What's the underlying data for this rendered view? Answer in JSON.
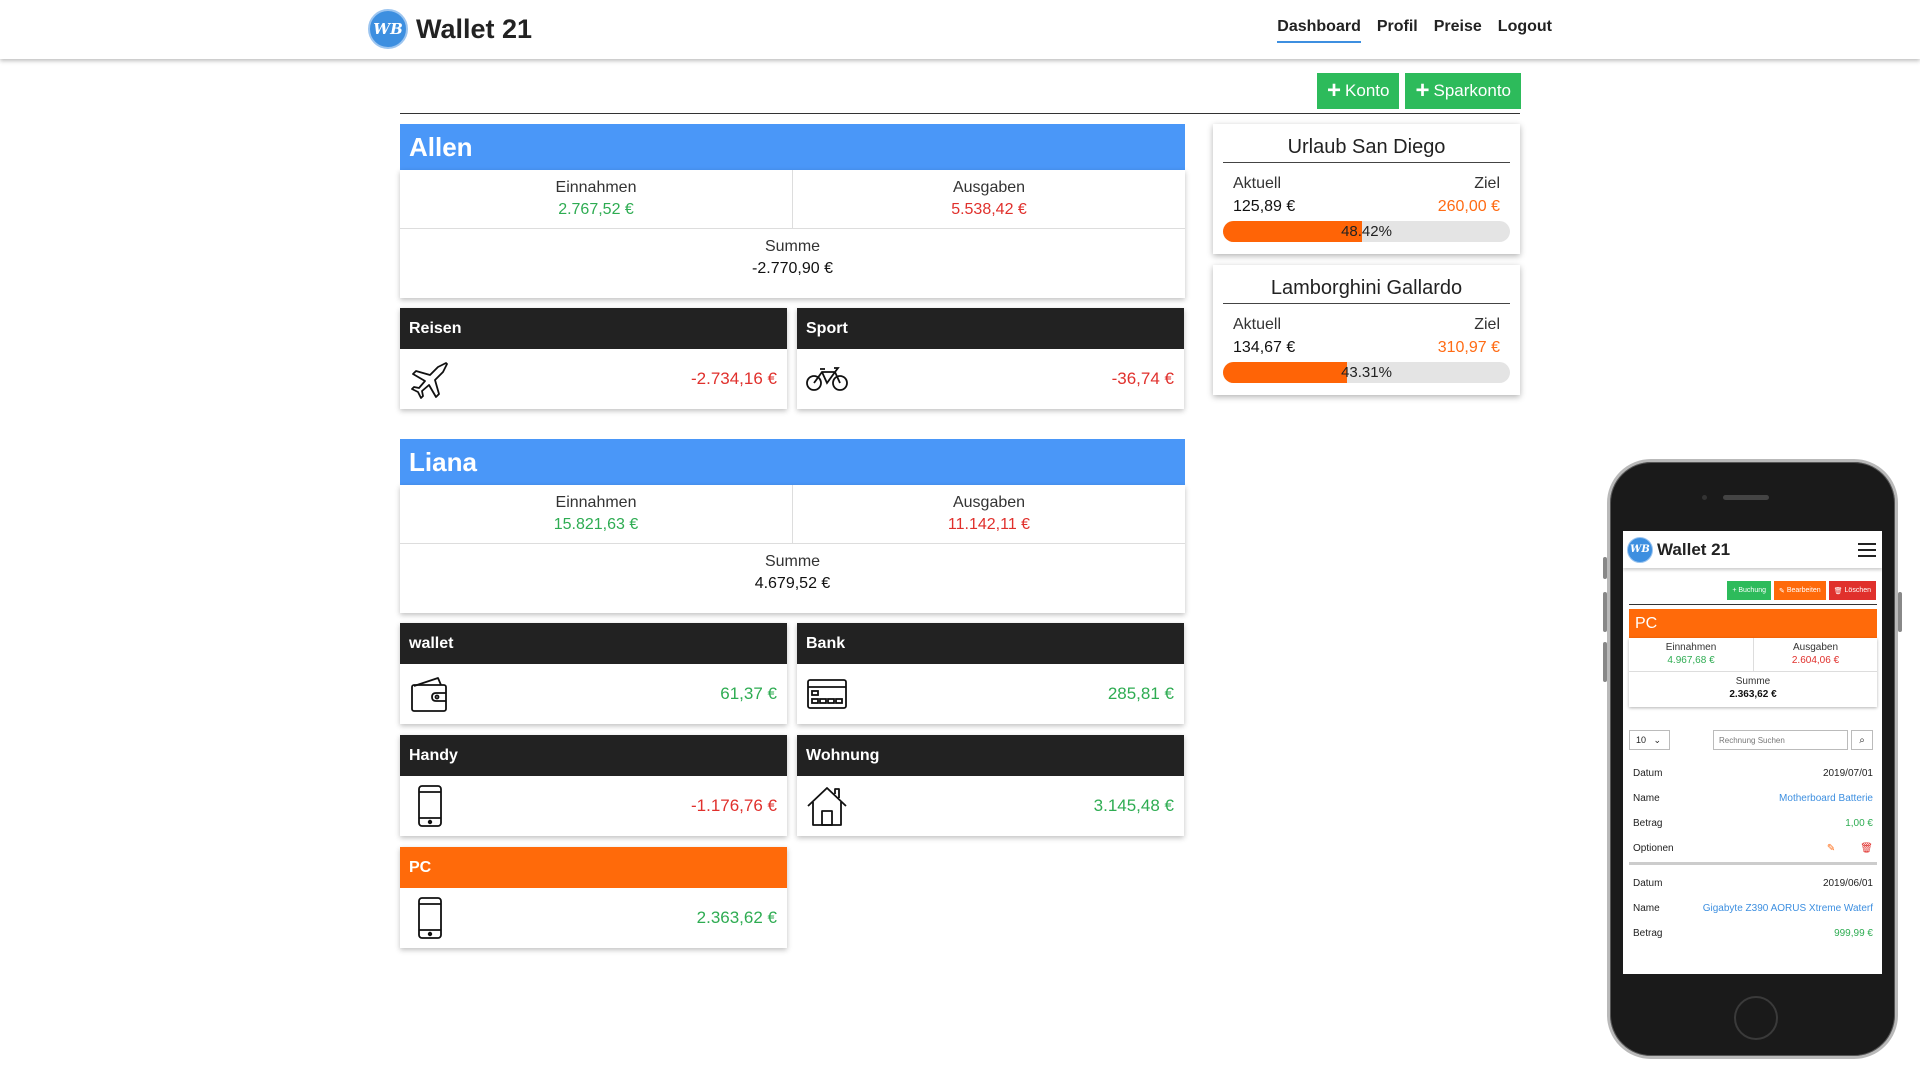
{
  "header": {
    "brand_logo": "WB",
    "brand": "Wallet 21",
    "nav": [
      "Dashboard",
      "Profil",
      "Preise",
      "Logout"
    ],
    "active_nav": "Dashboard"
  },
  "actions": {
    "add_account": "Konto",
    "add_savings": "Sparkonto"
  },
  "groups": [
    {
      "name": "Allen",
      "income_label": "Einnahmen",
      "income": "2.767,52 €",
      "expense_label": "Ausgaben",
      "expense": "5.538,42 €",
      "sum_label": "Summe",
      "sum": "-2.770,90 €",
      "accounts": [
        {
          "name": "Reisen",
          "icon": "airplane-icon",
          "value": "-2.734,16 €"
        },
        {
          "name": "Sport",
          "icon": "bicycle-icon",
          "value": "-36,74 €"
        }
      ]
    },
    {
      "name": "Liana",
      "income_label": "Einnahmen",
      "income": "15.821,63 €",
      "expense_label": "Ausgaben",
      "expense": "11.142,11 €",
      "sum_label": "Summe",
      "sum": "4.679,52 €",
      "accounts": [
        {
          "name": "wallet",
          "icon": "wallet-icon",
          "value": "61,37 €"
        },
        {
          "name": "Bank",
          "icon": "credit-card-icon",
          "value": "285,81 €"
        },
        {
          "name": "Handy",
          "icon": "smartphone-icon",
          "value": "-1.176,76 €"
        },
        {
          "name": "Wohnung",
          "icon": "house-icon",
          "value": "3.145,48 €"
        },
        {
          "name": "PC",
          "icon": "smartphone-icon",
          "value": "2.363,62 €"
        }
      ]
    }
  ],
  "goals": [
    {
      "title": "Urlaub San Diego",
      "current_label": "Aktuell",
      "target_label": "Ziel",
      "current": "125,89 €",
      "target": "260,00 €",
      "percent_text": "48.42%",
      "progress": 0.4842
    },
    {
      "title": "Lamborghini Gallardo",
      "current_label": "Aktuell",
      "target_label": "Ziel",
      "current": "134,67 €",
      "target": "310,97 €",
      "percent_text": "43.31%",
      "progress": 0.4331
    }
  ],
  "mobile": {
    "brand_logo": "WB",
    "brand": "Wallet 21",
    "buttons": [
      "Buchung",
      "Bearbeiten",
      "Löschen"
    ],
    "account": "PC",
    "income_label": "Einnahmen",
    "income": "4.967,68 €",
    "expense_label": "Ausgaben",
    "expense": "2.604,06 €",
    "sum_label": "Summe",
    "sum": "2.363,62 €",
    "page_size": "10",
    "search_placeholder": "Rechnung Suchen",
    "entries": [
      {
        "date_label": "Datum",
        "date": "2019/07/01",
        "name_label": "Name",
        "name": "Motherboard Batterie",
        "amount_label": "Betrag",
        "amount": "1,00 €",
        "options_label": "Optionen"
      },
      {
        "date_label": "Datum",
        "date": "2019/06/01",
        "name_label": "Name",
        "name": "Gigabyte Z390 AORUS Xtreme Waterf",
        "amount_label": "Betrag",
        "amount": "999,99 €"
      }
    ]
  },
  "colors": {
    "primary_blue": "#4a97f8",
    "green": "#2dbb5b",
    "red": "#e0302c",
    "orange": "#ff6a0a",
    "dark_header": "#222222"
  }
}
